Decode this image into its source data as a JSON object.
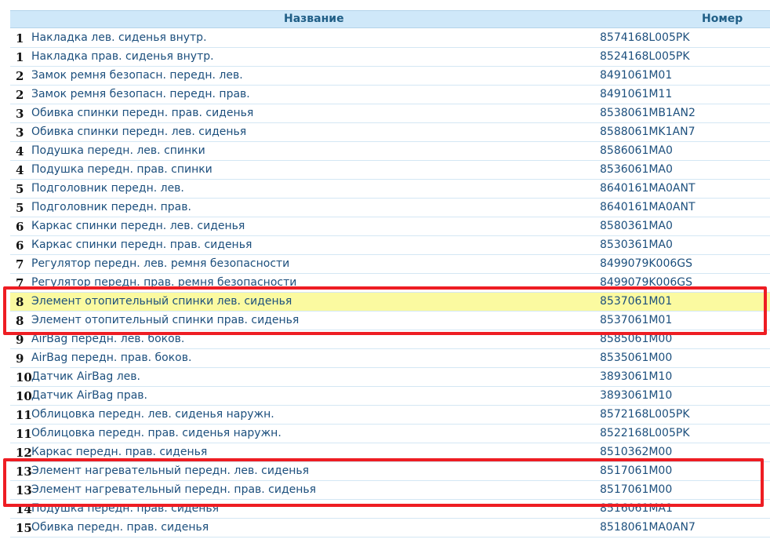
{
  "table": {
    "col_name": "Название",
    "col_number": "Номер",
    "rows": [
      {
        "idx": "1",
        "name": "Накладка лев. сиденья внутр.",
        "num": "8574168L005PK"
      },
      {
        "idx": "1",
        "name": "Накладка прав. сиденья внутр.",
        "num": "8524168L005PK"
      },
      {
        "idx": "2",
        "name": "Замок ремня безопасн. передн. лев.",
        "num": "8491061M01"
      },
      {
        "idx": "2",
        "name": "Замок ремня безопасн. передн. прав.",
        "num": "8491061M11"
      },
      {
        "idx": "3",
        "name": "Обивка спинки передн. прав. сиденья",
        "num": "8538061MB1AN2"
      },
      {
        "idx": "3",
        "name": "Обивка спинки передн. лев. сиденья",
        "num": "8588061MK1AN7"
      },
      {
        "idx": "4",
        "name": "Подушка передн. лев. спинки",
        "num": "8586061MA0"
      },
      {
        "idx": "4",
        "name": "Подушка передн. прав. спинки",
        "num": "8536061MA0"
      },
      {
        "idx": "5",
        "name": "Подголовник передн. лев.",
        "num": "8640161MA0ANT"
      },
      {
        "idx": "5",
        "name": "Подголовник передн. прав.",
        "num": "8640161MA0ANT"
      },
      {
        "idx": "6",
        "name": "Каркас спинки передн. лев. сиденья",
        "num": "8580361MA0"
      },
      {
        "idx": "6",
        "name": "Каркас спинки передн. прав. сиденья",
        "num": "8530361MA0"
      },
      {
        "idx": "7",
        "name": "Регулятор передн. лев. ремня безопасности",
        "num": "8499079K006GS"
      },
      {
        "idx": "7",
        "name": "Регулятор передн. прав. ремня безопасности",
        "num": "8499079K006GS"
      },
      {
        "idx": "8",
        "name": "Элемент отопительный спинки лев. сиденья",
        "num": "8537061M01"
      },
      {
        "idx": "8",
        "name": "Элемент отопительный спинки прав. сиденья",
        "num": "8537061M01"
      },
      {
        "idx": "9",
        "name": "AirBag передн. лев. боков.",
        "num": "8585061M00"
      },
      {
        "idx": "9",
        "name": "AirBag передн. прав. боков.",
        "num": "8535061M00"
      },
      {
        "idx": "10",
        "name": "Датчик AirBag лев.",
        "num": "3893061M10"
      },
      {
        "idx": "10",
        "name": "Датчик AirBag прав.",
        "num": "3893061M10"
      },
      {
        "idx": "11",
        "name": "Облицовка передн. лев. сиденья наружн.",
        "num": "8572168L005PK"
      },
      {
        "idx": "11",
        "name": "Облицовка передн. прав. сиденья наружн.",
        "num": "8522168L005PK"
      },
      {
        "idx": "12",
        "name": "Каркас передн. прав. сиденья",
        "num": "8510362M00"
      },
      {
        "idx": "13",
        "name": "Элемент нагревательный передн. лев. сиденья",
        "num": "8517061M00"
      },
      {
        "idx": "13",
        "name": "Элемент нагревательный передн. прав. сиденья",
        "num": "8517061M00"
      },
      {
        "idx": "14",
        "name": "Подушка передн. прав. сиденья",
        "num": "8516061MA1"
      },
      {
        "idx": "15",
        "name": "Обивка передн. прав. сиденья",
        "num": "8518061MA0AN7"
      }
    ]
  },
  "colors": {
    "header_bg": "#cfe8f9",
    "highlight_bg": "#fbfaa0",
    "callout_border": "#ee1d23",
    "text": "#1c4f7d"
  }
}
